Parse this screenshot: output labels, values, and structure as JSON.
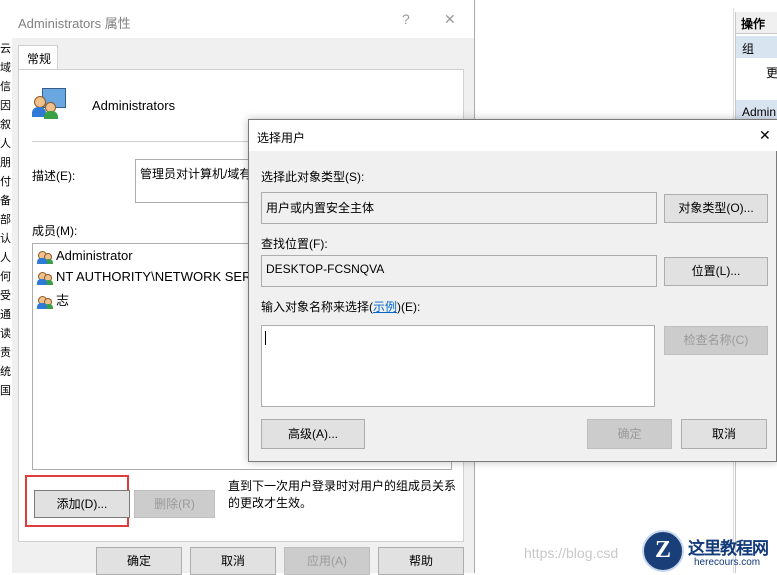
{
  "admin_props": {
    "title": "Administrators 属性",
    "help_icon": "?",
    "close_icon": "✕",
    "tab_general": "常规",
    "group_name": "Administrators",
    "desc_label": "描述(E):",
    "desc_value": "管理员对计算机/域有",
    "members_label": "成员(M):",
    "members": [
      "Administrator",
      "NT AUTHORITY\\NETWORK SERV",
      "志"
    ],
    "add_button": "添加(D)...",
    "remove_button": "删除(R)",
    "note": "直到下一次用户登录时对用户的组成员关系的更改才生效。",
    "ok_button": "确定",
    "cancel_button": "取消",
    "apply_button": "应用(A)",
    "help_button": "帮助"
  },
  "right_panel": {
    "header": "操作",
    "group_label": "组",
    "more_label": "更",
    "admin_label": "Admin"
  },
  "left_strip": [
    "云",
    "域",
    "信",
    "因",
    "叙",
    "人",
    "朋",
    "付",
    "备",
    "部",
    "认",
    "人",
    "何",
    "受",
    "通",
    "读",
    "责",
    "统",
    "国"
  ],
  "select_users": {
    "title": "选择用户",
    "close_icon": "✕",
    "object_type_label": "选择此对象类型(S):",
    "object_type_value": "用户或内置安全主体",
    "object_type_button": "对象类型(O)...",
    "location_label": "查找位置(F):",
    "location_value": "DESKTOP-FCSNQVA",
    "location_button": "位置(L)...",
    "names_label_prefix": "输入对象名称来选择(",
    "names_label_link": "示例",
    "names_label_suffix": ")(E):",
    "names_value": "",
    "check_names_button": "检查名称(C)",
    "advanced_button": "高级(A)...",
    "ok_button": "确定",
    "cancel_button": "取消"
  },
  "watermark": {
    "blog_text": "https://blog.csd",
    "site_cn": "这里教程网",
    "site_en": "herecours.com",
    "logo_letter": "Z"
  }
}
